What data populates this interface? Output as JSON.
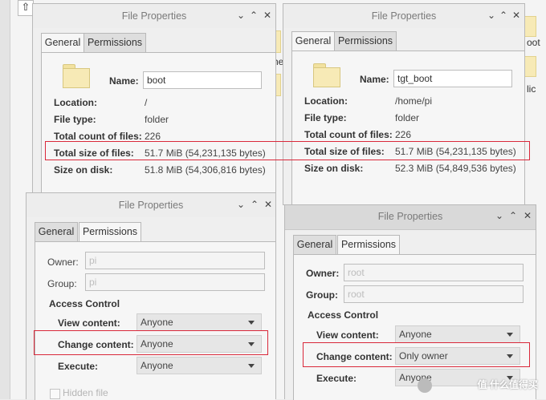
{
  "background": {
    "partial_labels": [
      "oot",
      "lic",
      "he"
    ]
  },
  "windows": [
    {
      "title": "File Properties",
      "tabs": [
        "General",
        "Permissions"
      ],
      "name_label": "Name:",
      "name_value": "boot",
      "rows": [
        {
          "label": "Location:",
          "value": "/"
        },
        {
          "label": "File type:",
          "value": "folder"
        },
        {
          "label": "Total count of files:",
          "value": "226"
        },
        {
          "label": "Total size of files:",
          "value": "51.7 MiB (54,231,135 bytes)"
        },
        {
          "label": "Size on disk:",
          "value": "51.8 MiB (54,306,816 bytes)"
        }
      ]
    },
    {
      "title": "File Properties",
      "tabs": [
        "General",
        "Permissions"
      ],
      "name_label": "Name:",
      "name_value": "tgt_boot",
      "rows": [
        {
          "label": "Location:",
          "value": "/home/pi"
        },
        {
          "label": "File type:",
          "value": "folder"
        },
        {
          "label": "Total count of files:",
          "value": "226"
        },
        {
          "label": "Total size of files:",
          "value": "51.7 MiB (54,231,135 bytes)"
        },
        {
          "label": "Size on disk:",
          "value": "52.3 MiB (54,849,536 bytes)"
        }
      ]
    },
    {
      "title": "File Properties",
      "tabs": [
        "General",
        "Permissions"
      ],
      "owner_label": "Owner:",
      "owner_value": "pi",
      "group_label": "Group:",
      "group_value": "pi",
      "access_control": "Access Control",
      "perms": [
        {
          "label": "View content:",
          "value": "Anyone"
        },
        {
          "label": "Change content:",
          "value": "Anyone"
        },
        {
          "label": "Execute:",
          "value": "Anyone"
        }
      ],
      "hidden_file": "Hidden file"
    },
    {
      "title": "File Properties",
      "tabs": [
        "General",
        "Permissions"
      ],
      "owner_label": "Owner:",
      "owner_value": "root",
      "group_label": "Group:",
      "group_value": "root",
      "access_control": "Access Control",
      "perms": [
        {
          "label": "View content:",
          "value": "Anyone"
        },
        {
          "label": "Change content:",
          "value": "Only owner"
        },
        {
          "label": "Execute:",
          "value": "Anyone"
        }
      ]
    }
  ],
  "window_buttons": {
    "close": "✕",
    "minimize": "⌄",
    "maximize": "⌃"
  },
  "watermark": "值 什么值得买",
  "colors": {
    "highlight_box": "#d9283a",
    "folder": "#f7eab6"
  }
}
